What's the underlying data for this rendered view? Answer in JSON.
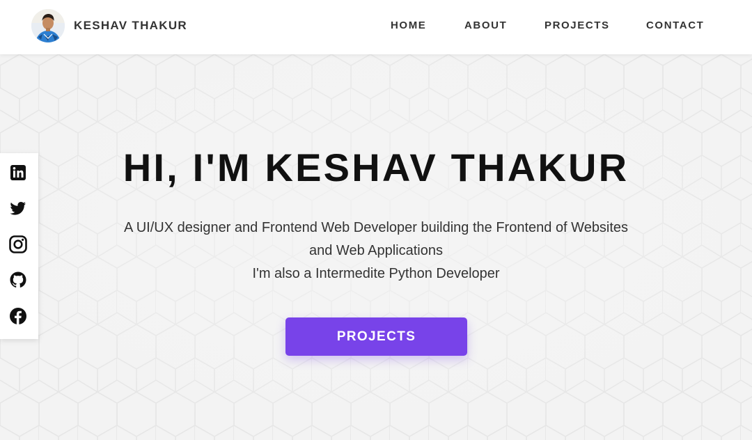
{
  "header": {
    "brand": "KESHAV THAKUR",
    "nav": [
      {
        "label": "HOME"
      },
      {
        "label": "ABOUT"
      },
      {
        "label": "PROJECTS"
      },
      {
        "label": "CONTACT"
      }
    ]
  },
  "social": [
    {
      "icon": "linkedin-icon"
    },
    {
      "icon": "twitter-icon"
    },
    {
      "icon": "instagram-icon"
    },
    {
      "icon": "github-icon"
    },
    {
      "icon": "facebook-icon"
    }
  ],
  "hero": {
    "title": "HI, I'M KESHAV THAKUR",
    "line1": "A UI/UX designer and Frontend Web Developer building the Frontend of Websites",
    "line2": "and Web Applications",
    "line3": "I'm also a Intermedite Python Developer",
    "button": "PROJECTS"
  },
  "colors": {
    "accent": "#7843e9",
    "background": "#f3f3f3",
    "header": "#ffffff",
    "text": "#111111"
  }
}
